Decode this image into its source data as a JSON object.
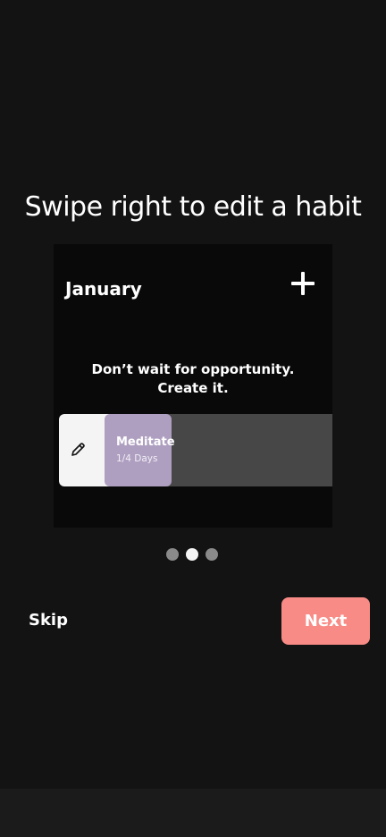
{
  "onboarding": {
    "title": "Swipe right to edit a habit",
    "preview": {
      "month": "January",
      "add_icon": "plus-icon",
      "quote": "Don’t wait for opportunity. Create it.",
      "habit": {
        "name": "Meditate",
        "progress": "1/4 Days",
        "edit_icon": "pencil-icon",
        "card_color": "#ae9fc0"
      }
    },
    "pager": {
      "total": 3,
      "active_index": 1
    },
    "skip_label": "Skip",
    "next_label": "Next",
    "colors": {
      "background": "#131313",
      "accent": "#f98b86"
    }
  }
}
